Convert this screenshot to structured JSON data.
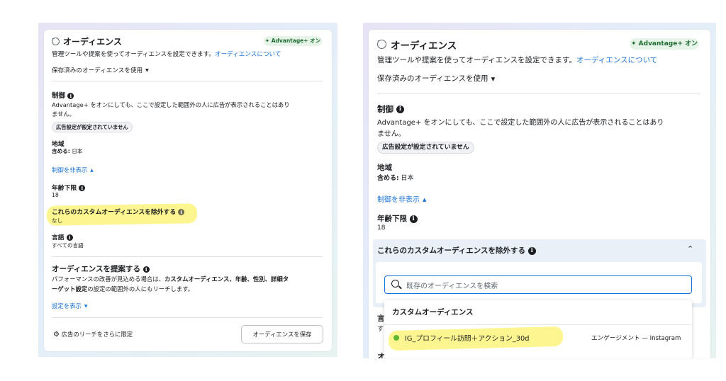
{
  "common": {
    "audience_title": "オーディエンス",
    "advantage_badge": "✦ Advantage+ オン",
    "description": "管理ツールや提案を使ってオーディエンスを設定できます。",
    "about_link": "オーディエンスについて",
    "saved_audience": "保存済みのオーディエンスを使用",
    "control_title": "制御",
    "control_desc_line1": "Advantage+ をオンにしても、ここで設定した範囲外の人に広告が表示されることはあり",
    "control_desc_line2": "ません。",
    "ad_settings_pill": "広告設定が設定されていません",
    "region_label": "地域",
    "region_include_label": "含める:",
    "region_value": "日本",
    "hide_control_link": "制御を非表示",
    "min_age_label": "年齢下限",
    "min_age_value": "18",
    "exclude_audience_label": "これらのカスタムオーディエンスを除外する"
  },
  "left_panel": {
    "exclude_value": "なし",
    "language_label": "言語",
    "language_value": "すべての言語",
    "suggest_title": "オーディエンスを提案する",
    "suggest_desc_line1_a": "パフォーマンスの改善が見込める場合は、",
    "suggest_desc_line1_b": "カスタムオーディエンス、年齢、性別、詳細タ",
    "suggest_desc_line2_a": "ーゲット設定",
    "suggest_desc_line2_b": "の設定の範囲外の人にもリーチします。",
    "show_settings_link": "設定を表示",
    "limit_reach": "広告のリーチをさらに限定",
    "save_button": "オーディエンスを保存"
  },
  "right_panel": {
    "search_placeholder": "既存のオーディエンスを検索",
    "dropdown_header": "カスタムオーディエンス",
    "audience_item_name": "IG_プロフィール訪問＋アクション_30d",
    "audience_item_source": "エンゲージメント — Instagram",
    "peek_lang_char": "言",
    "peek_lang_sub": "す",
    "peek_bottom_char": "オ"
  },
  "colors": {
    "link": "#1a73d8",
    "highlight": "#fdf58a",
    "badge_bg": "#e6f4e8",
    "status_dot": "#5fb832"
  }
}
